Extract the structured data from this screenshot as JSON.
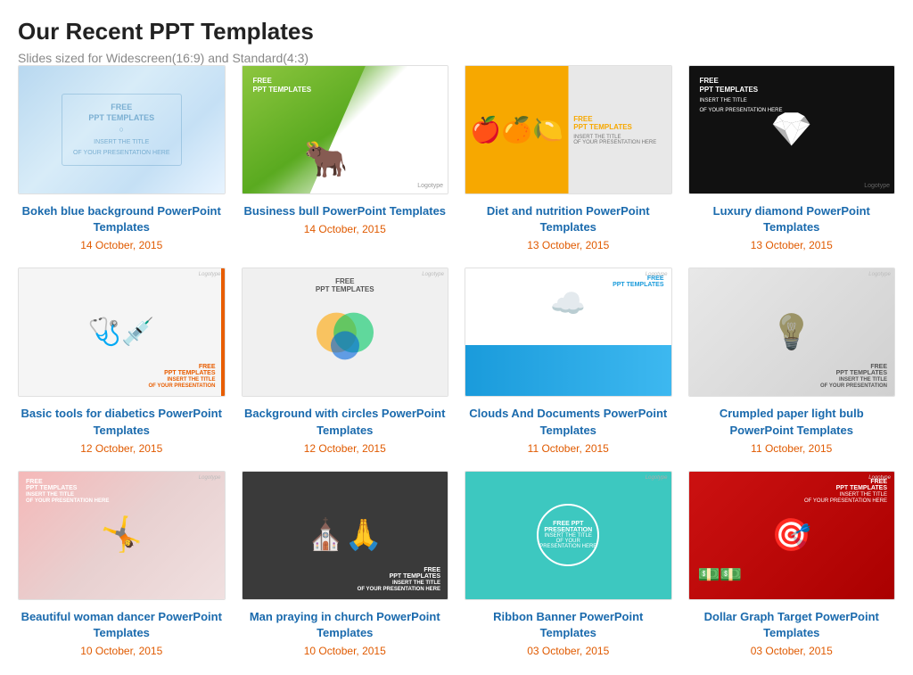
{
  "header": {
    "title": "Our Recent PPT Templates",
    "subtitle": "Slides sized for Widescreen(16:9) and Standard(4:3)"
  },
  "templates": [
    {
      "id": "bokeh-blue",
      "title": "Bokeh blue background PowerPoint Templates",
      "date": "14 October, 2015",
      "thumb_type": "bokeh"
    },
    {
      "id": "business-bull",
      "title": "Business bull PowerPoint Templates",
      "date": "14 October, 2015",
      "thumb_type": "bull"
    },
    {
      "id": "diet-nutrition",
      "title": "Diet and nutrition PowerPoint Templates",
      "date": "13 October, 2015",
      "thumb_type": "diet"
    },
    {
      "id": "luxury-diamond",
      "title": "Luxury diamond PowerPoint Templates",
      "date": "13 October, 2015",
      "thumb_type": "luxury"
    },
    {
      "id": "basic-tools-diabetics",
      "title": "Basic tools for diabetics PowerPoint Templates",
      "date": "12 October, 2015",
      "thumb_type": "diabetics"
    },
    {
      "id": "background-circles",
      "title": "Background with circles PowerPoint Templates",
      "date": "12 October, 2015",
      "thumb_type": "circles"
    },
    {
      "id": "clouds-documents",
      "title": "Clouds And Documents PowerPoint Templates",
      "date": "11 October, 2015",
      "thumb_type": "clouds"
    },
    {
      "id": "crumpled-paper-bulb",
      "title": "Crumpled paper light bulb PowerPoint Templates",
      "date": "11 October, 2015",
      "thumb_type": "bulb"
    },
    {
      "id": "woman-dancer",
      "title": "Beautiful woman dancer PowerPoint Templates",
      "date": "10 October, 2015",
      "thumb_type": "dancer"
    },
    {
      "id": "man-church",
      "title": "Man praying in church PowerPoint Templates",
      "date": "10 October, 2015",
      "thumb_type": "church"
    },
    {
      "id": "ribbon-banner",
      "title": "Ribbon Banner PowerPoint Templates",
      "date": "03 October, 2015",
      "thumb_type": "ribbon"
    },
    {
      "id": "dollar-graph",
      "title": "Dollar Graph Target PowerPoint Templates",
      "date": "03 October, 2015",
      "thumb_type": "dollar"
    }
  ],
  "free_label": "FREE",
  "ppt_label": "PPT TEMPLATES",
  "watermark": "Logotype"
}
